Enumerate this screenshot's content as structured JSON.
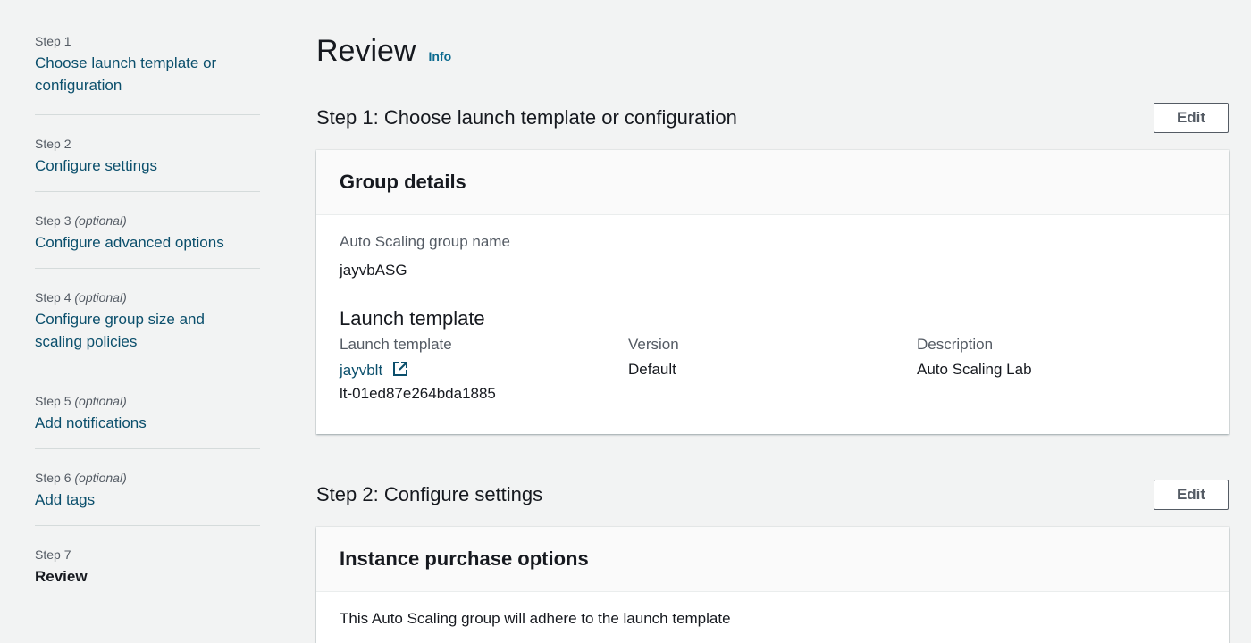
{
  "sidebar": {
    "steps": [
      {
        "label": "Step 1",
        "optional": "",
        "title": "Choose launch template or configuration"
      },
      {
        "label": "Step 2",
        "optional": "",
        "title": "Configure settings"
      },
      {
        "label": "Step 3",
        "optional": "(optional)",
        "title": "Configure advanced options"
      },
      {
        "label": "Step 4",
        "optional": "(optional)",
        "title": "Configure group size and scaling policies"
      },
      {
        "label": "Step 5",
        "optional": "(optional)",
        "title": "Add notifications"
      },
      {
        "label": "Step 6",
        "optional": "(optional)",
        "title": "Add tags"
      },
      {
        "label": "Step 7",
        "optional": "",
        "title": "Review"
      }
    ]
  },
  "page": {
    "title": "Review",
    "info": "Info"
  },
  "section1": {
    "title": "Step 1: Choose launch template or configuration",
    "edit_label": "Edit",
    "panel_title": "Group details",
    "asg_name_label": "Auto Scaling group name",
    "asg_name_value": "jayvbASG",
    "lt_heading": "Launch template",
    "lt_col_label": "Launch template",
    "lt_link": "jayvblt",
    "lt_id": "lt-01ed87e264bda1885",
    "version_label": "Version",
    "version_value": "Default",
    "description_label": "Description",
    "description_value": "Auto Scaling Lab"
  },
  "section2": {
    "title": "Step 2: Configure settings",
    "edit_label": "Edit",
    "panel_title": "Instance purchase options",
    "body_text": "This Auto Scaling group will adhere to the launch template"
  }
}
